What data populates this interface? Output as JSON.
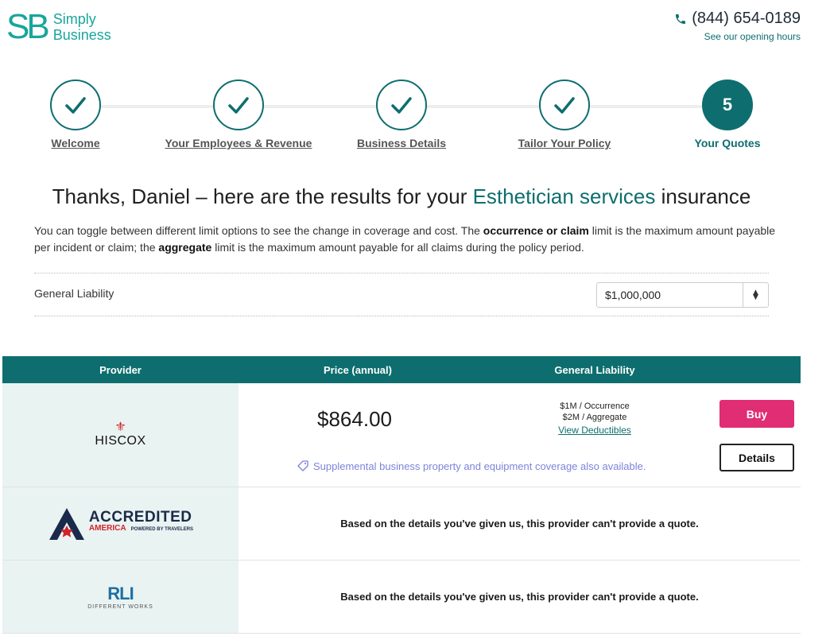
{
  "header": {
    "logo_mark": "SB",
    "logo_line1": "Simply",
    "logo_line2": "Business",
    "phone": "(844) 654-0189",
    "hours_link": "See our opening hours"
  },
  "stepper": {
    "steps": [
      {
        "label": "Welcome",
        "state": "complete"
      },
      {
        "label": "Your Employees & Revenue",
        "state": "complete"
      },
      {
        "label": "Business Details",
        "state": "complete"
      },
      {
        "label": "Tailor Your Policy",
        "state": "complete"
      },
      {
        "label": "Your Quotes",
        "state": "current",
        "number": "5"
      }
    ]
  },
  "main": {
    "headline_pre": "Thanks, Daniel – here are the results for your ",
    "headline_highlight": "Esthetician services",
    "headline_post": " insurance",
    "intro_1": "You can toggle between different limit options to see the change in coverage and cost. The ",
    "intro_bold_1": "occurrence or claim",
    "intro_2": " limit is the maximum amount payable per incident or claim; the ",
    "intro_bold_2": "aggregate",
    "intro_3": " limit is the maximum amount payable for all claims during the policy period.",
    "limit_label": "General Liability",
    "limit_value": "$1,000,000"
  },
  "table": {
    "headers": {
      "provider": "Provider",
      "price": "Price (annual)",
      "gl": "General Liability"
    },
    "quote": {
      "provider": "HISCOX",
      "price": "$864.00",
      "occurrence": "$1M / Occurrence",
      "aggregate": "$2M / Aggregate",
      "deductibles_link": "View Deductibles",
      "buy_label": "Buy",
      "details_label": "Details",
      "supplemental": "Supplemental business property and equipment coverage also available."
    },
    "accredited": {
      "name_big": "ACCREDITED",
      "name_small": "AMERICA",
      "powered": "POWERED BY TRAVELERS",
      "message": "Based on the details you've given us, this provider can't provide a quote."
    },
    "rli": {
      "name_big": "RLI",
      "tagline": "DIFFERENT WORKS",
      "message": "Based on the details you've given us, this provider can't provide a quote."
    }
  },
  "colors": {
    "brand": "#18a69b",
    "primary": "#0e6e6f",
    "buy": "#e02d74",
    "provider_bg": "#e9f3f2"
  }
}
